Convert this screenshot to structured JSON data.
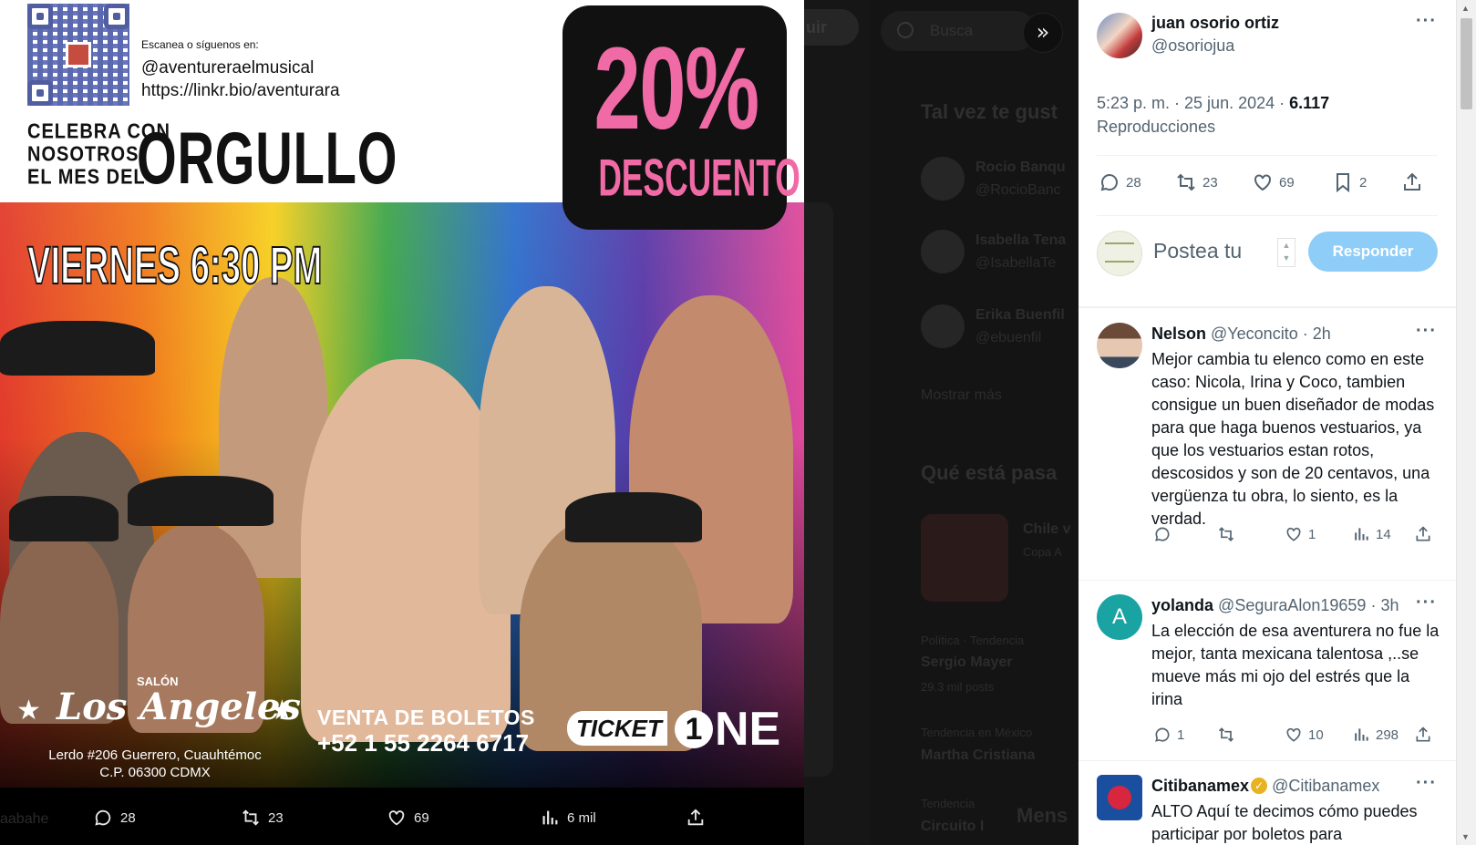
{
  "background": {
    "follow_button_fragment": "uir",
    "search_placeholder": "Busca",
    "who_to_follow_title": "Tal vez te gust",
    "suggestions": [
      {
        "name": "Rocio Banqu",
        "handle": "@RocioBanc"
      },
      {
        "name": "Isabella Tena",
        "handle": "@IsabellaTe"
      },
      {
        "name": "Erika Buenfil",
        "handle": "@ebuenfil"
      }
    ],
    "show_more": "Mostrar más",
    "whats_happening_title": "Qué está pasa",
    "trend_card_title": "Chile v",
    "trend_card_sub": "Copa A",
    "trends": [
      {
        "category": "Política · Tendencia",
        "name": "Sergio Mayer",
        "posts": "29.3 mil posts"
      },
      {
        "category": "Tendencia en México",
        "name": "Martha Cristiana",
        "posts": ""
      },
      {
        "category": "Tendencia",
        "name": "Circuito I",
        "posts": ""
      }
    ],
    "messages_label": "Mens",
    "left_fragment": "aabahe"
  },
  "poster": {
    "social_prompt": "Escanea o síguenos en:",
    "social_handle": "@aventureraelmusical",
    "social_link": "https://linkr.bio/aventurara",
    "celebra_lines": [
      "CELEBRA CON",
      "NOSOTROS",
      "EL MES DEL"
    ],
    "orgullo": "ORGULLO",
    "discount_pct": "20%",
    "discount_word": "DESCUENTO",
    "showtime": "VIERNES 6:30 PM",
    "salon_label": "SALÓN",
    "venue": "Los Angeles",
    "address_line1": "Lerdo #206 Guerrero, Cuauhtémoc",
    "address_line2": "C.P. 06300 CDMX",
    "tickets_label": "VENTA DE BOLETOS",
    "tickets_phone": "+52 1 55 2264 6717",
    "ticket_brand": "TICKET",
    "ticket_brand_num": "1",
    "ticket_brand_end": "NE"
  },
  "media_actions": {
    "replies": "28",
    "reposts": "23",
    "likes": "69",
    "views": "6 mil"
  },
  "post": {
    "author_name": "juan osorio ortiz",
    "author_handle": "@osoriojua",
    "timestamp": "5:23 p. m. · 25 jun. 2024 · ",
    "views_count": "6.117",
    "views_label": "Reproducciones",
    "replies": "28",
    "reposts": "23",
    "likes": "69",
    "bookmarks": "2",
    "reply_placeholder": "Postea tu",
    "reply_button": "Responder"
  },
  "replies": [
    {
      "name": "Nelson",
      "handle": "@Yeconcito",
      "time": "· 2h",
      "text": "Mejor cambia tu elenco como en este caso: Nicola, Irina y Coco, tambien consigue un buen diseñador de modas para que haga buenos vestuarios, ya que los vestuarios estan rotos, descosidos y son de 20 centavos, una vergüenza tu obra, lo siento, es la verdad.",
      "replies": "",
      "reposts": "",
      "likes": "1",
      "views": "14"
    },
    {
      "name": "yolanda",
      "handle": "@SeguraAlon19659",
      "time": "· 3h",
      "avatar_letter": "A",
      "text": "La elección de esa aventurera no fue la mejor, tanta mexicana talentosa ,..se  mueve más mi ojo del estrés que la irina",
      "replies": "1",
      "reposts": "",
      "likes": "10",
      "views": "298"
    },
    {
      "name": "Citibanamex",
      "handle": "@Citibanamex",
      "time": "",
      "text": "ALTO Aquí te decimos cómo puedes participar por boletos para"
    }
  ],
  "colors": {
    "accent_pink": "#f06aa6",
    "reply_button": "#8ecdf8",
    "verified_gold": "#e8b321",
    "muted_text": "#536471"
  }
}
